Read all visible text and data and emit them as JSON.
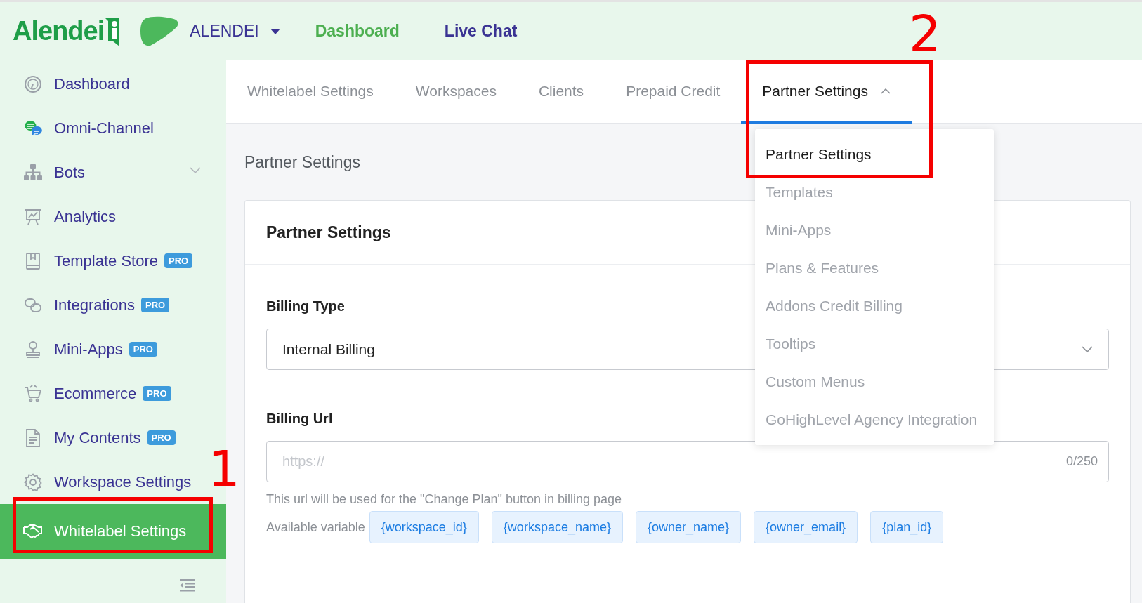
{
  "brand": {
    "logo_text": "Alendei",
    "workspace": "ALENDEI"
  },
  "nav": [
    {
      "label": "Dashboard",
      "selected": true
    },
    {
      "label": "Live Chat",
      "selected": false
    }
  ],
  "sidebar": {
    "items": [
      {
        "label": "Dashboard",
        "selected": false
      },
      {
        "label": "Omni-Channel",
        "selected": false
      },
      {
        "label": "Bots",
        "selected": false,
        "expanded": false
      },
      {
        "label": "Analytics",
        "selected": false
      },
      {
        "label": "Template Store",
        "badge": "PRO",
        "selected": false
      },
      {
        "label": "Integrations",
        "badge": "PRO",
        "selected": false
      },
      {
        "label": "Mini-Apps",
        "badge": "PRO",
        "selected": false
      },
      {
        "label": "Ecommerce",
        "badge": "PRO",
        "selected": false
      },
      {
        "label": "My Contents",
        "badge": "PRO",
        "selected": false
      },
      {
        "label": "Workspace Settings",
        "selected": false
      },
      {
        "label": "Whitelabel Settings",
        "selected": true
      }
    ]
  },
  "tabs": [
    {
      "label": "Whitelabel Settings",
      "selected": false
    },
    {
      "label": "Workspaces",
      "selected": false
    },
    {
      "label": "Clients",
      "selected": false
    },
    {
      "label": "Prepaid Credit",
      "selected": false
    },
    {
      "label": "Partner Settings",
      "selected": true,
      "expanded": true
    }
  ],
  "tab_menu": {
    "items": [
      {
        "label": "Partner Settings",
        "selected": true
      },
      {
        "label": "Templates",
        "selected": false
      },
      {
        "label": "Mini-Apps",
        "selected": false
      },
      {
        "label": "Plans & Features",
        "selected": false
      },
      {
        "label": "Addons Credit Billing",
        "selected": false
      },
      {
        "label": "Tooltips",
        "selected": false
      },
      {
        "label": "Custom Menus",
        "selected": false
      },
      {
        "label": "GoHighLevel Agency Integration",
        "selected": false
      }
    ]
  },
  "page_title": "Partner Settings",
  "card": {
    "title": "Partner Settings",
    "billing_type": {
      "label": "Billing Type",
      "value": "Internal Billing"
    },
    "billing_url": {
      "label": "Billing Url",
      "placeholder": "https://",
      "counter": "0/250",
      "help": "This url will be used for the \"Change Plan\" button in billing page",
      "variables_label": "Available variable",
      "variables": [
        "{workspace_id}",
        "{workspace_name}",
        "{owner_name}",
        "{owner_email}",
        "{plan_id}"
      ]
    }
  },
  "annotations": [
    {
      "label": "1"
    },
    {
      "label": "2"
    }
  ]
}
